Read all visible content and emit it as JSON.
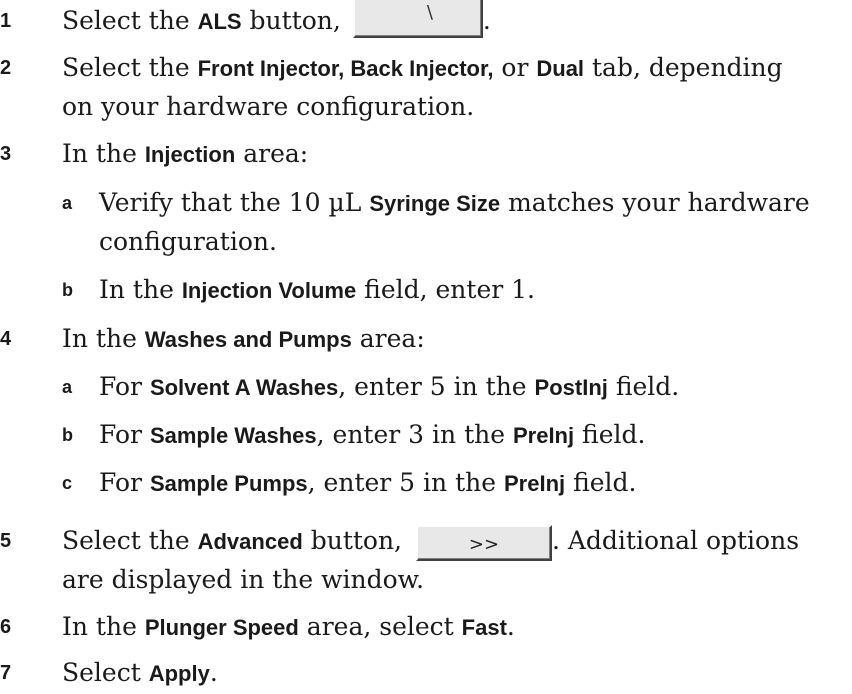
{
  "steps": [
    {
      "num": "1",
      "a": "Select the ",
      "b": "ALS",
      "c": " button, ",
      "d": "."
    },
    {
      "num": "2",
      "a": "Select the ",
      "b1": "Front Injector, Back Injector,",
      "c": " or ",
      "b2": "Dual",
      "d": " tab, depending",
      "line2": "on your hardware configuration."
    },
    {
      "num": "3",
      "a": "In the ",
      "b": "Injection",
      "c": " area:"
    },
    {
      "num": "4",
      "a": "In the ",
      "b": "Washes and Pumps",
      "c": " area:"
    },
    {
      "num": "5",
      "a": "Select the ",
      "b": "Advanced",
      "c": " button, ",
      "d": ". Additional options",
      "line2": "are displayed in the window."
    },
    {
      "num": "6",
      "a": "In the ",
      "b1": "Plunger Speed",
      "c": " area, select ",
      "b2": "Fast",
      "d": "."
    },
    {
      "num": "7",
      "a": "Select ",
      "b": "Apply",
      "c": "."
    }
  ],
  "sub3": [
    {
      "num": "a",
      "a": "Verify that the 10 µL ",
      "b": "Syringe Size",
      "c": " matches your hardware",
      "line2": "configuration."
    },
    {
      "num": "b",
      "a": "In the ",
      "b": "Injection Volume",
      "c": " field, enter 1."
    }
  ],
  "sub4": [
    {
      "num": "a",
      "a": "For ",
      "b1": "Solvent A Washes",
      "c": ", enter 5 in the ",
      "b2": "PostInj",
      "d": " field."
    },
    {
      "num": "b",
      "a": "For ",
      "b1": "Sample Washes",
      "c": ", enter 3 in the ",
      "b2": "PreInj",
      "d": " field."
    },
    {
      "num": "c",
      "a": "For ",
      "b1": "Sample Pumps",
      "c": ", enter 5 in the ",
      "b2": "PreInj",
      "d": " field."
    }
  ],
  "buttons": {
    "advanced_glyph": ">>",
    "als_glyph": "\\"
  }
}
